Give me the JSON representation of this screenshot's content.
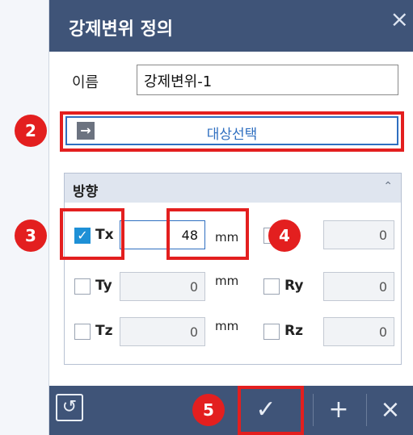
{
  "dialog": {
    "title": "강제변위 정의",
    "close_glyph": "×"
  },
  "name_field": {
    "label": "이름",
    "value": "강제변위-1"
  },
  "target_button": {
    "icon": "arrow-right-icon",
    "label": "대상선택"
  },
  "direction": {
    "header": "방향",
    "collapse_icon": "chevron-up-icon",
    "rows": [
      {
        "left": {
          "label": "Tx",
          "checked": true,
          "value": "48",
          "unit": "mm"
        },
        "right": {
          "label": "",
          "checked": false,
          "value": "0"
        }
      },
      {
        "left": {
          "label": "Ty",
          "checked": false,
          "value": "0",
          "unit": "mm"
        },
        "right": {
          "label": "Ry",
          "checked": false,
          "value": "0"
        }
      },
      {
        "left": {
          "label": "Tz",
          "checked": false,
          "value": "0",
          "unit": "mm"
        },
        "right": {
          "label": "Rz",
          "checked": false,
          "value": "0"
        }
      }
    ]
  },
  "footer": {
    "reset_icon": "reset-icon",
    "ok_glyph": "✓",
    "add_glyph": "+",
    "cancel_glyph": "×"
  },
  "annotations": {
    "step2": "2",
    "step3": "3",
    "step4": "4",
    "step5": "5"
  },
  "colors": {
    "titlebar": "#3f5478",
    "accent": "#2f6fc0",
    "checkbox_checked": "#1e90d6",
    "annotation_red": "#e31f1f"
  }
}
